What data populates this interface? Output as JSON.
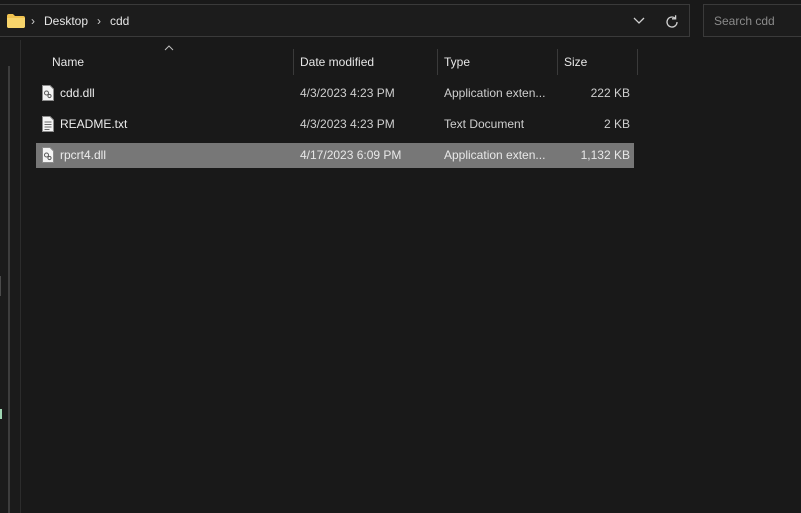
{
  "breadcrumb": {
    "items": [
      "Desktop",
      "cdd"
    ]
  },
  "search": {
    "placeholder": "Search cdd"
  },
  "columns": {
    "name": "Name",
    "date": "Date modified",
    "type": "Type",
    "size": "Size"
  },
  "files": [
    {
      "name": "cdd.dll",
      "date": "4/3/2023 4:23 PM",
      "type": "Application exten...",
      "size": "222 KB",
      "icon": "dll-file-icon",
      "selected": false
    },
    {
      "name": "README.txt",
      "date": "4/3/2023 4:23 PM",
      "type": "Text Document",
      "size": "2 KB",
      "icon": "text-file-icon",
      "selected": false
    },
    {
      "name": "rpcrt4.dll",
      "date": "4/17/2023 6:09 PM",
      "type": "Application exten...",
      "size": "1,132 KB",
      "icon": "dll-file-icon",
      "selected": true
    }
  ],
  "colors": {
    "background": "#191919",
    "selection": "#777777",
    "folder": "#f0c24f"
  }
}
